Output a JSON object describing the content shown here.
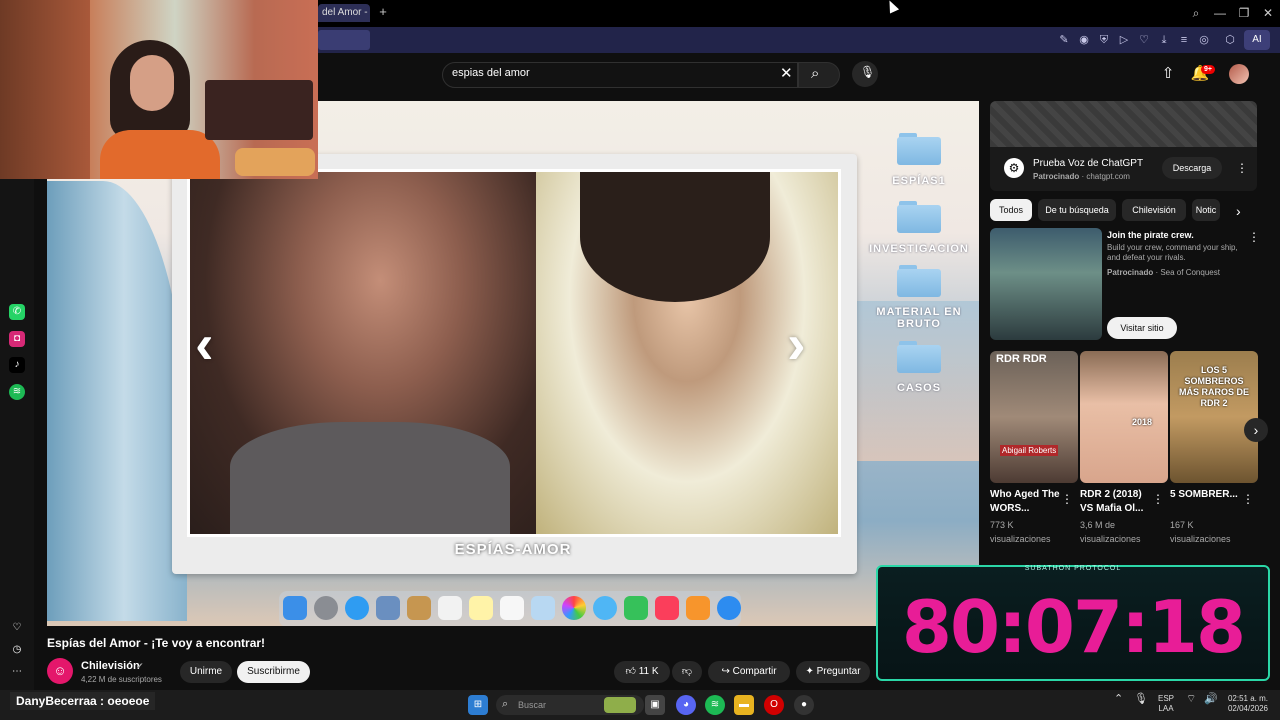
{
  "browser": {
    "tab_title": "del Amor - ¡Te",
    "new_tab": "+",
    "ai_label": "AI"
  },
  "youtube": {
    "search": {
      "value": "espias del amor"
    },
    "notifications_badge": "9+",
    "video": {
      "title": "Espías del Amor - ¡Te voy a encontrar!",
      "logo_text": "ESPÍAS-AMOR",
      "folders": [
        "ESPÍAS1",
        "INVESTIGACION",
        "MATERIAL EN BRUTO",
        "CASOS"
      ]
    },
    "channel": {
      "name": "Chilevisión",
      "subscribers": "4,22 M de suscriptores",
      "join_label": "Unirme",
      "subscribe_label": "Suscribirme"
    },
    "actions": {
      "likes": "11 K",
      "share": "Compartir",
      "ask": "Preguntar"
    },
    "ad1": {
      "title": "Prueba Voz de ChatGPT",
      "sponsored": "Patrocinado",
      "domain": "chatgpt.com",
      "button": "Descarga"
    },
    "chips": [
      "Todos",
      "De tu búsqueda",
      "Chilevisión",
      "Notic"
    ],
    "ad2": {
      "title": "Join the pirate crew.",
      "description": "Build your crew, command your ship, and defeat your rivals.",
      "sponsored": "Patrocinado",
      "advertiser": "Sea of Conquest",
      "button": "Visitar sitio"
    },
    "related": [
      {
        "title": "Who Aged The WORS...",
        "views": "773 K",
        "views_label": "visualizaciones",
        "thumb_text": "RDR  RDR"
      },
      {
        "title": "RDR 2 (2018) VS Mafia Ol...",
        "views": "3,6 M de",
        "views_label": "visualizaciones",
        "thumb_text": "2018"
      },
      {
        "title": "5 SOMBRER...",
        "views": "167 K",
        "views_label": "visualizaciones",
        "thumb_text": "LOS 5 SOMBREROS MÁS RAROS DE RDR 2"
      }
    ]
  },
  "overlays": {
    "timer": "80:07:18",
    "timer_label": "SUBATHON PROTOCOL",
    "chat_message": "DanyBecerraa : oeoeoe"
  },
  "taskbar": {
    "search_placeholder": "Buscar",
    "lang_top": "ESP",
    "lang_bottom": "LAA",
    "time": "02:51 a. m.",
    "date": "02/04/2026"
  },
  "colors": {
    "timer_pink": "#e81d97",
    "timer_border": "#2bd7a7",
    "youtube_bg": "#0f0f0f"
  }
}
